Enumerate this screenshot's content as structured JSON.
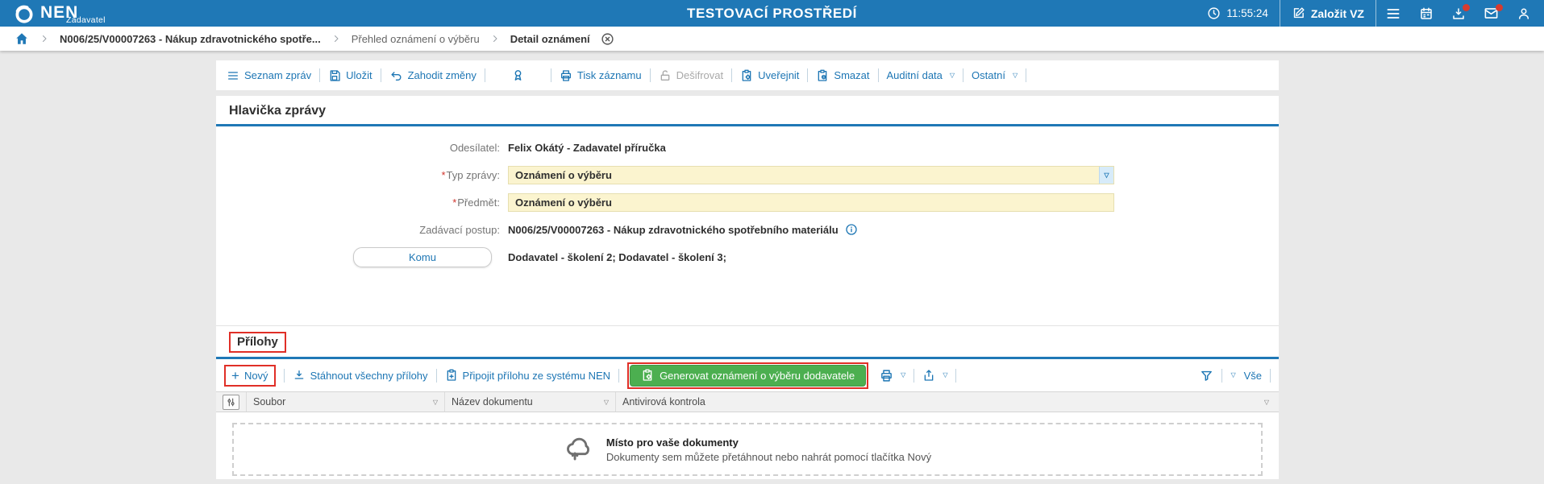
{
  "topbar": {
    "brand": "NEN",
    "brand_sub": "Zadavatel",
    "environment": "TESTOVACÍ PROSTŘEDÍ",
    "time": "11:55:24",
    "zalozit_vz": "Založit VZ"
  },
  "breadcrumb": {
    "items": [
      "N006/25/V00007263 - Nákup zdravotnického spotře...",
      "Přehled oznámení o výběru",
      "Detail oznámení"
    ]
  },
  "message_toolbar": {
    "seznam_zprav": "Seznam zpráv",
    "ulozit": "Uložit",
    "zahodit_zmeny": "Zahodit změny",
    "tisk_zaznamu": "Tisk záznamu",
    "desifrovat": "Dešifrovat",
    "uverejnit": "Uveřejnit",
    "smazat": "Smazat",
    "auditni_data": "Auditní data",
    "ostatni": "Ostatní"
  },
  "message_header": {
    "title": "Hlavička zprávy",
    "required_marker": "*",
    "odesilatel_label": "Odesílatel:",
    "odesilatel_value": "Felix Okátý - Zadavatel příručka",
    "typ_zpravy_label": "Typ zprávy:",
    "typ_zpravy_value": "Oznámení o výběru",
    "predmet_label": "Předmět:",
    "predmet_value": "Oznámení o výběru",
    "zadavaci_postup_label": "Zadávací postup:",
    "zadavaci_postup_value": "N006/25/V00007263 - Nákup zdravotnického spotřebního materiálu",
    "komu_label": "Komu",
    "komu_value": "Dodavatel - školení 2; Dodavatel - školení 3;"
  },
  "attachments": {
    "title": "Přílohy",
    "toolbar": {
      "novy": "Nový",
      "stahnout_vsechny": "Stáhnout všechny přílohy",
      "pripojit_nen": "Připojit přílohu ze systému NEN",
      "generovat": "Generovat oznámení o výběru dodavatele",
      "vse": "Vše"
    },
    "table": {
      "columns": [
        "Soubor",
        "Název dokumentu",
        "Antivirová kontrola"
      ]
    },
    "empty_state": {
      "title": "Místo pro vaše dokumenty",
      "subtitle": "Dokumenty sem můžete přetáhnout nebo nahrát pomocí tlačítka Nový"
    }
  },
  "colors": {
    "accent_blue": "#1f78b6",
    "link_blue": "#1d76b4",
    "field_yellow": "#fbf4cf",
    "button_green": "#4caf50",
    "annotation_red": "#e02f27",
    "badge_red": "#d63b2f"
  }
}
